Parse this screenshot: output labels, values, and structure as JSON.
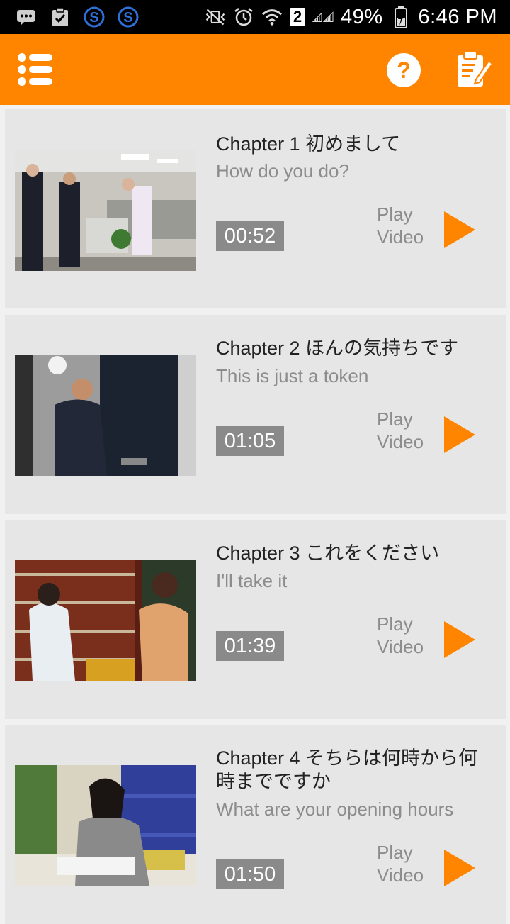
{
  "status_bar": {
    "battery": "49%",
    "time": "6:46 PM",
    "sim_badge": "2",
    "icons": [
      "chat-icon",
      "clipboard-check-icon",
      "s-app-icon",
      "s-app-icon",
      "mute-vibrate-icon",
      "alarm-icon",
      "wifi-icon",
      "signal-icon",
      "battery-icon"
    ]
  },
  "app_bar": {
    "background_color": "#ff8400",
    "icons": [
      "menu-list-icon",
      "help-icon",
      "notes-icon"
    ]
  },
  "chapters": [
    {
      "title": "Chapter 1 初めまして",
      "subtitle": "How do you do?",
      "duration": "00:52",
      "play_label_line1": "Play",
      "play_label_line2": "Video",
      "thumbnail": "office-greeting-scene"
    },
    {
      "title": "Chapter 2 ほんの気持ちです",
      "subtitle": "This is just a token",
      "duration": "01:05",
      "play_label_line1": "Play",
      "play_label_line2": "Video",
      "thumbnail": "man-at-door-scene"
    },
    {
      "title": "Chapter 3 これをください",
      "subtitle": "I'll take it",
      "duration": "01:39",
      "play_label_line1": "Play",
      "play_label_line2": "Video",
      "thumbnail": "wine-shop-scene"
    },
    {
      "title": "Chapter 4 そちらは何時から何時までですか",
      "subtitle": "What are your opening hours",
      "duration": "01:50",
      "play_label_line1": "Play",
      "play_label_line2": "Video",
      "thumbnail": "woman-on-phone-scene"
    }
  ]
}
